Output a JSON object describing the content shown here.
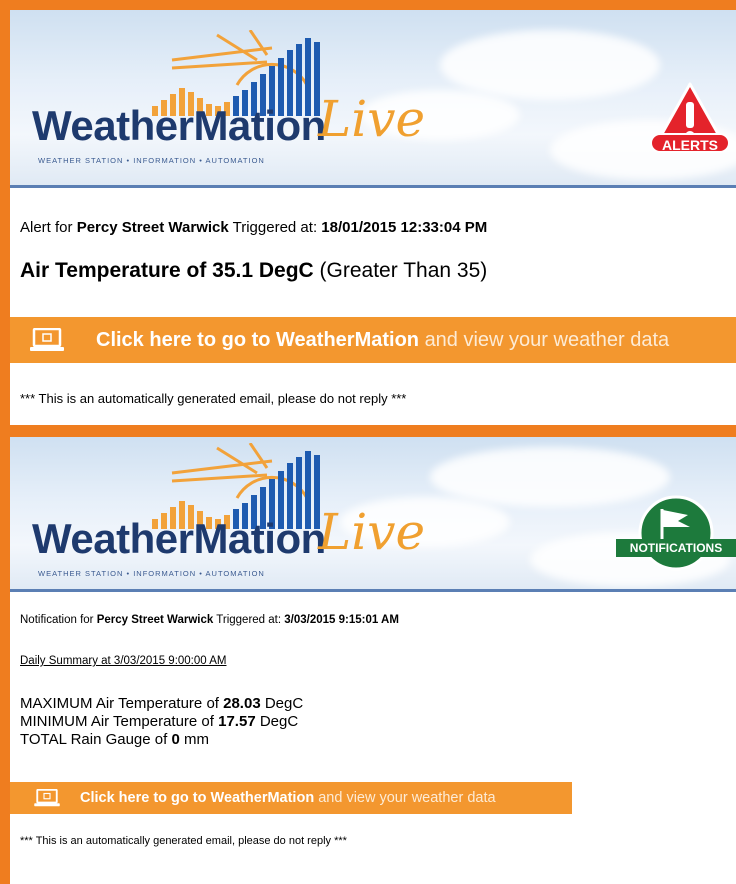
{
  "alert": {
    "brand": "WeatherMation",
    "live": "Live",
    "tagline": "WEATHER STATION • INFORMATION • AUTOMATION",
    "badge_label": "ALERTS",
    "line1_prefix": "Alert for",
    "location": "Percy Street Warwick",
    "triggered_label": "Triggered at:",
    "timestamp": "18/01/2015 12:33:04 PM",
    "headline_bold": "Air Temperature of 35.1 DegC",
    "headline_rest": "(Greater Than 35)",
    "cta_bold": "Click here to go to WeatherMation",
    "cta_rest": "and view your weather data",
    "footer": "*** This is an automatically generated email, please do not reply ***"
  },
  "notification": {
    "brand": "WeatherMation",
    "live": "Live",
    "tagline": "WEATHER STATION • INFORMATION • AUTOMATION",
    "badge_label": "NOTIFICATIONS",
    "line1_prefix": "Notification for",
    "location": "Percy Street Warwick",
    "triggered_label": "Triggered at:",
    "timestamp": "3/03/2015 9:15:01 AM",
    "summary_link": "Daily Summary at 3/03/2015 9:00:00 AM",
    "max_label": "MAXIMUM Air Temperature of",
    "max_value": "28.03",
    "max_unit": "DegC",
    "min_label": "MINIMUM Air Temperature of",
    "min_value": "17.57",
    "min_unit": "DegC",
    "rain_label": "TOTAL Rain Gauge of",
    "rain_value": "0",
    "rain_unit": "mm",
    "cta_bold": "Click here to go to WeatherMation",
    "cta_rest": "and view your weather data",
    "footer": "*** This is an automatically generated email, please do not reply ***"
  },
  "colors": {
    "frame": "#ef7d1f",
    "cta": "#f3972f",
    "brand_blue": "#1e3a6e",
    "alert_red": "#e4232b",
    "notif_green": "#1d7a3c"
  },
  "icons": [
    "alert-triangle-icon",
    "flag-icon",
    "laptop-icon",
    "sun-logo-icon",
    "bar-chart-logo-icon"
  ]
}
